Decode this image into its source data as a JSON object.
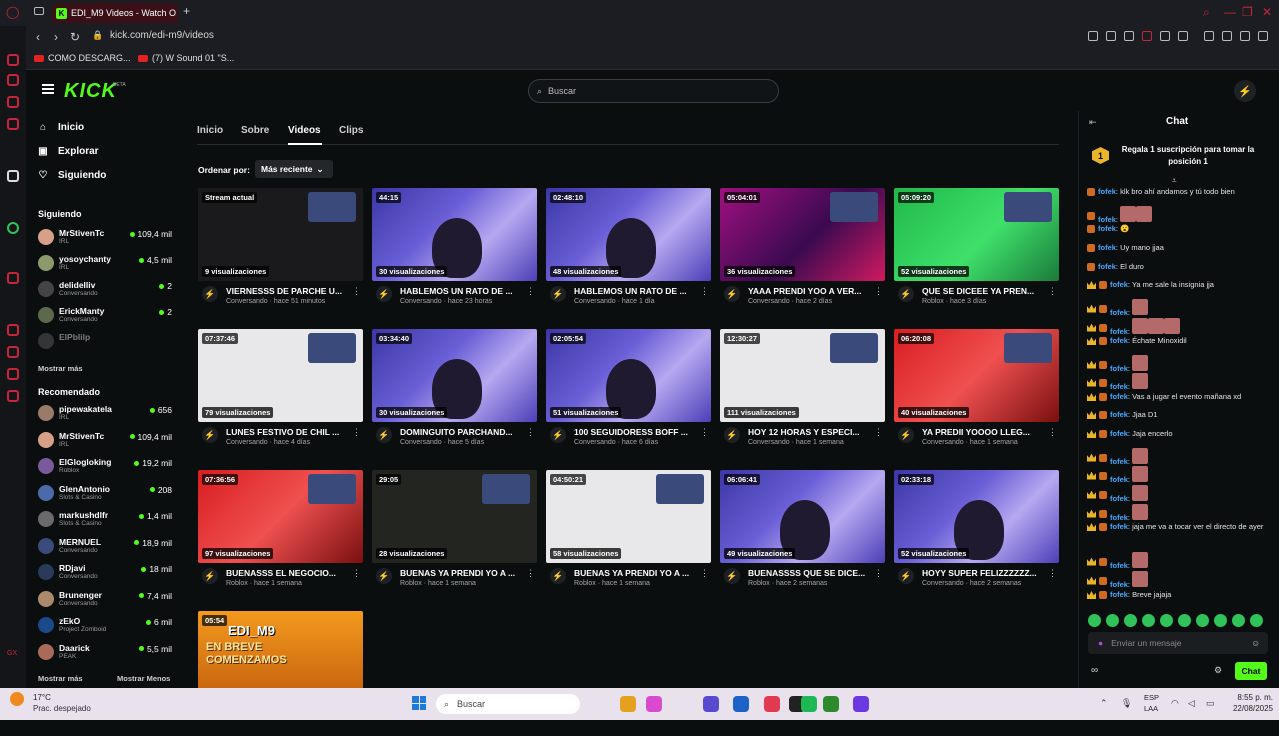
{
  "browser": {
    "tab_title": "EDI_M9 Videos - Watch O",
    "tab_favicon": "K",
    "new_tab": "+",
    "url": "kick.com/edi-m9/videos",
    "bookmarks": [
      "COMO DESCARG...",
      "(7) W Sound 01 \"S..."
    ]
  },
  "header": {
    "logo": "KICK",
    "logo_badge": "BETA",
    "search_placeholder": "Buscar",
    "search_icon": "search-icon"
  },
  "sidebar": {
    "nav": [
      {
        "label": "Inicio",
        "icon": "home-icon"
      },
      {
        "label": "Explorar",
        "icon": "compass-icon"
      },
      {
        "label": "Siguiendo",
        "icon": "heart-icon"
      }
    ],
    "following_title": "Siguiendo",
    "following": [
      {
        "name": "MrStivenTc",
        "category": "IRL",
        "viewers": "109,4 mil",
        "color": "#d9a089"
      },
      {
        "name": "yosoychanty",
        "category": "IRL",
        "viewers": "4,5 mil",
        "color": "#8a9a6a"
      },
      {
        "name": "delidelliv",
        "category": "Conversando",
        "viewers": "2",
        "color": "#444"
      },
      {
        "name": "ErickManty",
        "category": "Conversando",
        "viewers": "2",
        "color": "#5a6a4a"
      },
      {
        "name": "ElPblilp",
        "category": "",
        "viewers": "",
        "color": "#666"
      }
    ],
    "following_more": "Mostrar más",
    "recommended_title": "Recomendado",
    "recommended": [
      {
        "name": "pipewakatela",
        "category": "IRL",
        "viewers": "656",
        "color": "#9a7a6a"
      },
      {
        "name": "MrStivenTc",
        "category": "IRL",
        "viewers": "109,4 mil",
        "color": "#d9a089"
      },
      {
        "name": "ElGlogloking",
        "category": "Roblox",
        "viewers": "19,2 mil",
        "color": "#7a5a9a"
      },
      {
        "name": "GlenAntonio",
        "category": "Slots & Casino",
        "viewers": "208",
        "color": "#4a6aaa"
      },
      {
        "name": "markushdlfr",
        "category": "Slots & Casino",
        "viewers": "1,4 mil",
        "color": "#6a6a6a"
      },
      {
        "name": "MERNUEL",
        "category": "Conversando",
        "viewers": "18,9 mil",
        "color": "#3a4a7a"
      },
      {
        "name": "RDjavi",
        "category": "Conversando",
        "viewers": "18 mil",
        "color": "#2a3a5a"
      },
      {
        "name": "Brunenger",
        "category": "Conversando",
        "viewers": "7,4 mil",
        "color": "#aa8a6a"
      },
      {
        "name": "zEkO",
        "category": "Project Zomboid",
        "viewers": "6 mil",
        "color": "#1a4a8a"
      },
      {
        "name": "Daarick",
        "category": "PEAK",
        "viewers": "5,5 mil",
        "color": "#aa6a5a"
      }
    ],
    "recommended_more": "Mostrar más",
    "recommended_less": "Mostrar Menos"
  },
  "main": {
    "tabs": [
      "Inicio",
      "Sobre",
      "Videos",
      "Clips"
    ],
    "active_tab": "Videos",
    "order_label": "Ordenar por:",
    "order_value": "Más reciente",
    "videos": [
      {
        "duration": "Stream actual",
        "views": "9 visualizaciones",
        "title": "VIERNESSS DE PARCHE U...",
        "category": "Conversando",
        "time": "hace 51 minutos",
        "art": "stream"
      },
      {
        "duration": "44:15",
        "views": "30 visualizaciones",
        "title": "HABLEMOS UN RATO DE ...",
        "category": "Conversando",
        "time": "hace 23 horas",
        "art": "room"
      },
      {
        "duration": "02:48:10",
        "views": "48 visualizaciones",
        "title": "HABLEMOS UN RATO DE ...",
        "category": "Conversando",
        "time": "hace 1 día",
        "art": "room"
      },
      {
        "duration": "05:04:01",
        "views": "36 visualizaciones",
        "title": "YAAA PRENDI YOO A VER...",
        "category": "Conversando",
        "time": "hace 2 días",
        "art": "magenta"
      },
      {
        "duration": "05:09:20",
        "views": "52 visualizaciones",
        "title": "QUE SE DICEEE YA PREN...",
        "category": "Roblox",
        "time": "hace 3 días",
        "art": "green"
      },
      {
        "duration": "07:37:46",
        "views": "79 visualizaciones",
        "title": "LUNES FESTIVO DE CHIL ...",
        "category": "Conversando",
        "time": "hace 4 días",
        "art": "white"
      },
      {
        "duration": "03:34:40",
        "views": "30 visualizaciones",
        "title": "DOMINGUITO PARCHAND...",
        "category": "Conversando",
        "time": "hace 5 días",
        "art": "room"
      },
      {
        "duration": "02:05:54",
        "views": "51 visualizaciones",
        "title": "100 SEGUIDORESS BOFF ...",
        "category": "Conversando",
        "time": "hace 6 días",
        "art": "room"
      },
      {
        "duration": "12:30:27",
        "views": "111 visualizaciones",
        "title": "HOY 12 HORAS Y ESPECI...",
        "category": "Conversando",
        "time": "hace 1 semana",
        "art": "white"
      },
      {
        "duration": "06:20:08",
        "views": "40 visualizaciones",
        "title": "YA PREDII YOOOO LLEG...",
        "category": "Conversando",
        "time": "hace 1 semana",
        "art": "red"
      },
      {
        "duration": "07:36:56",
        "views": "97 visualizaciones",
        "title": "BUENASSS EL NEGOCIO...",
        "category": "Roblox",
        "time": "hace 1 semana",
        "art": "red"
      },
      {
        "duration": "29:05",
        "views": "28 visualizaciones",
        "title": "BUENAS YA PRENDI YO A ...",
        "category": "Roblox",
        "time": "hace 1 semana",
        "art": "dark"
      },
      {
        "duration": "04:50:21",
        "views": "58 visualizaciones",
        "title": "BUENAS YA PRENDI YO A ...",
        "category": "Roblox",
        "time": "hace 1 semana",
        "art": "white"
      },
      {
        "duration": "06:06:41",
        "views": "49 visualizaciones",
        "title": "BUENASSSS QUE SE DICE...",
        "category": "Roblox",
        "time": "hace 2 semanas",
        "art": "room"
      },
      {
        "duration": "02:33:18",
        "views": "52 visualizaciones",
        "title": "HOYY SUPER FELIZZZZZZ...",
        "category": "Conversando",
        "time": "hace 2 semanas",
        "art": "room"
      },
      {
        "duration": "05:54",
        "views": "",
        "title": "",
        "category": "",
        "time": "",
        "art": "orange",
        "overlay_title": "EDI_M9",
        "overlay_sub": "EN BREVE COMENZAMOS"
      }
    ]
  },
  "chat": {
    "title": "Chat",
    "sub_text": "Regala 1 suscripción para tomar la posición 1",
    "sub_rank": "1",
    "messages": [
      {
        "user": "fofek",
        "text": "klk bro ahí andamos y tú todo bien",
        "crown": false,
        "emotes": 0
      },
      {
        "user": "fofek",
        "text": "",
        "crown": false,
        "emotes": 2
      },
      {
        "user": "fofek",
        "text": "😮",
        "crown": false,
        "emotes": 0
      },
      {
        "user": "fofek",
        "text": "Uy mano jjaa",
        "crown": false,
        "emotes": 0
      },
      {
        "user": "fofek",
        "text": "El duro",
        "crown": false,
        "emotes": 0
      },
      {
        "user": "fofek",
        "text": "Ya me sale la insignia jja",
        "crown": true,
        "emotes": 0
      },
      {
        "user": "fofek",
        "text": "",
        "crown": true,
        "emotes": 1
      },
      {
        "user": "fofek",
        "text": "",
        "crown": true,
        "emotes": 3
      },
      {
        "user": "fofek",
        "text": "Échate Minoxidil",
        "crown": true,
        "emotes": 0
      },
      {
        "user": "fofek",
        "text": "",
        "crown": true,
        "emotes": 1
      },
      {
        "user": "fofek",
        "text": "",
        "crown": true,
        "emotes": 1
      },
      {
        "user": "fofek",
        "text": "Vas a jugar el evento mañana xd",
        "crown": true,
        "emotes": 0
      },
      {
        "user": "fofek",
        "text": "Jjaa D1",
        "crown": true,
        "emotes": 0
      },
      {
        "user": "fofek",
        "text": "Jaja encerlo",
        "crown": true,
        "emotes": 0
      },
      {
        "user": "fofek",
        "text": "",
        "crown": true,
        "emotes": 1
      },
      {
        "user": "fofek",
        "text": "",
        "crown": true,
        "emotes": 1
      },
      {
        "user": "fofek",
        "text": "",
        "crown": true,
        "emotes": 1
      },
      {
        "user": "fofek",
        "text": "",
        "crown": true,
        "emotes": 1
      },
      {
        "user": "fofek",
        "text": "jaja me va a tocar ver el directo de ayer",
        "crown": true,
        "emotes": 0
      },
      {
        "user": "fofek",
        "text": "",
        "crown": true,
        "emotes": 1
      },
      {
        "user": "fofek",
        "text": "",
        "crown": true,
        "emotes": 1
      },
      {
        "user": "fofek",
        "text": "Breve jajaja",
        "crown": true,
        "emotes": 0
      }
    ],
    "input_placeholder": "Enviar un mensaje",
    "send_label": "Chat",
    "infinity": "∞"
  },
  "taskbar": {
    "weather_temp": "17°C",
    "weather_desc": "Prac. despejado",
    "search_placeholder": "Buscar",
    "lang1": "ESP",
    "lang2": "LAA",
    "time": "8:55 p. m.",
    "date": "22/08/2025",
    "colors": [
      "#e6a020",
      "#d94ad0",
      "#5a4ad0",
      "#1d62c8",
      "#e03a50",
      "#222222",
      "#1db954",
      "#2d8a2d",
      "#6a3ae0"
    ]
  },
  "colors": {
    "brand": "#53fc18",
    "opera_red": "#c4263a",
    "chat_user": "#4aa8ff"
  }
}
